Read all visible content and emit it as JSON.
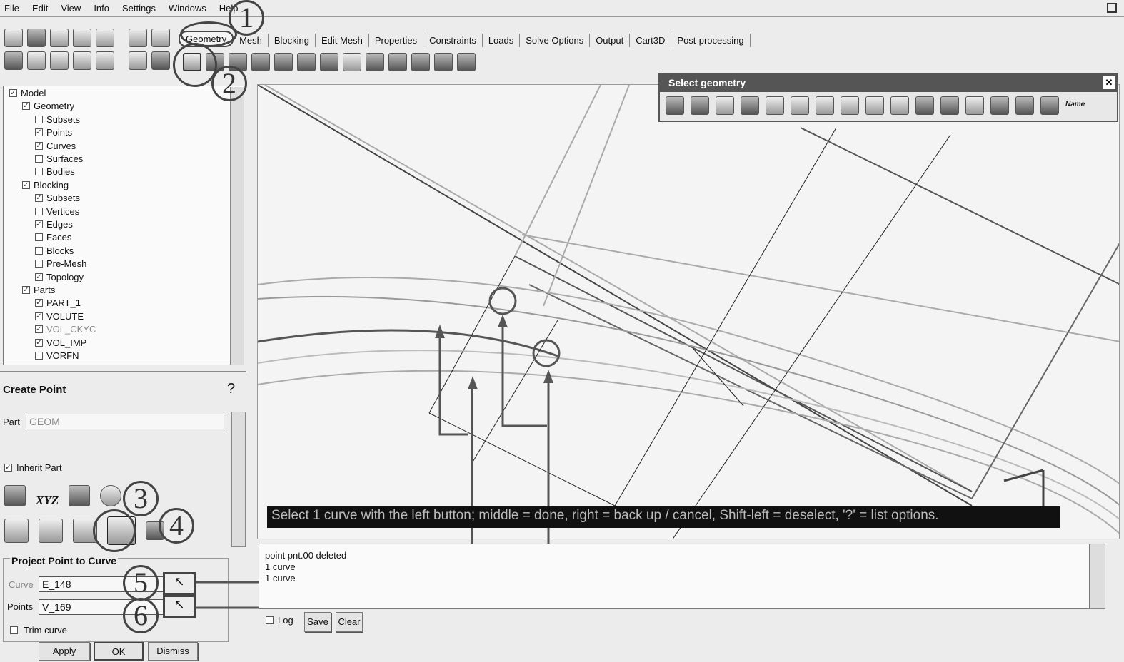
{
  "menu": [
    "File",
    "Edit",
    "View",
    "Info",
    "Settings",
    "Windows",
    "Help"
  ],
  "tabs": [
    "Geometry",
    "Mesh",
    "Blocking",
    "Edit Mesh",
    "Properties",
    "Constraints",
    "Loads",
    "Solve Options",
    "Output",
    "Cart3D",
    "Post-processing"
  ],
  "tree": [
    {
      "label": "Model",
      "level": 0,
      "checked": true
    },
    {
      "label": "Geometry",
      "level": 1,
      "checked": true
    },
    {
      "label": "Subsets",
      "level": 2,
      "checked": false
    },
    {
      "label": "Points",
      "level": 2,
      "checked": true
    },
    {
      "label": "Curves",
      "level": 2,
      "checked": true
    },
    {
      "label": "Surfaces",
      "level": 2,
      "checked": false
    },
    {
      "label": "Bodies",
      "level": 2,
      "checked": false
    },
    {
      "label": "Blocking",
      "level": 1,
      "checked": true
    },
    {
      "label": "Subsets",
      "level": 2,
      "checked": true
    },
    {
      "label": "Vertices",
      "level": 2,
      "checked": false
    },
    {
      "label": "Edges",
      "level": 2,
      "checked": true
    },
    {
      "label": "Faces",
      "level": 2,
      "checked": false
    },
    {
      "label": "Blocks",
      "level": 2,
      "checked": false
    },
    {
      "label": "Pre-Mesh",
      "level": 2,
      "checked": false
    },
    {
      "label": "Topology",
      "level": 2,
      "checked": true
    },
    {
      "label": "Parts",
      "level": 1,
      "checked": true
    },
    {
      "label": "PART_1",
      "level": 2,
      "checked": true
    },
    {
      "label": "VOLUTE",
      "level": 2,
      "checked": true
    },
    {
      "label": "VOL_CKYC",
      "level": 2,
      "checked": true,
      "dim": true
    },
    {
      "label": "VOL_IMP",
      "level": 2,
      "checked": true
    },
    {
      "label": "VORFN",
      "level": 2,
      "checked": false
    }
  ],
  "create_point": {
    "title": "Create Point",
    "part_label": "Part",
    "part_value": "GEOM",
    "inherit_label": "Inherit Part",
    "xyz": "XYZ",
    "section": "Project Point to Curve",
    "curve_label": "Curve",
    "curve_value": "E_148",
    "points_label": "Points",
    "points_value": "V_169",
    "trim_label": "Trim curve",
    "apply": "Apply",
    "ok": "OK",
    "dismiss": "Dismiss"
  },
  "select_geometry": {
    "title": "Select geometry",
    "name_label": "Name"
  },
  "prompt": "Select 1 curve with the left button; middle = done, right = back up / cancel, Shift-left = deselect, '?' = list options.",
  "messages": [
    "point pnt.00 deleted",
    "1 curve",
    "1 curve"
  ],
  "log": {
    "label": "Log",
    "save": "Save",
    "clear": "Clear"
  },
  "annotations": [
    "1",
    "2",
    "3",
    "4",
    "5",
    "6"
  ]
}
